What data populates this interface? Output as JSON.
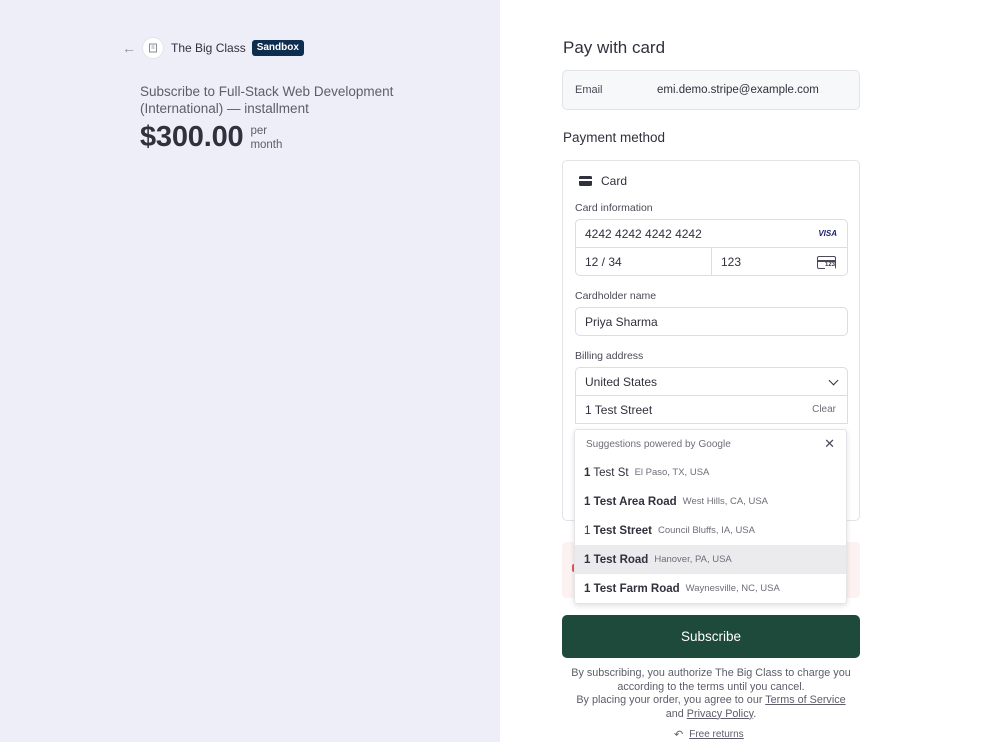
{
  "merchant": {
    "name": "The Big Class",
    "badge": "Sandbox"
  },
  "product": {
    "name": "Subscribe to Full-Stack Web Development (International) — installment",
    "price": "$300.00",
    "period_line1": "per",
    "period_line2": "month"
  },
  "checkout": {
    "title": "Pay with card",
    "email_label": "Email",
    "email_value": "emi.demo.stripe@example.com",
    "payment_method_title": "Payment method",
    "card_tab_label": "Card",
    "card_info_label": "Card information",
    "card_number": "4242 4242 4242 4242",
    "card_brand": "VISA",
    "expiry": "12 / 34",
    "cvc": "123",
    "cvc_icon_text": "123",
    "cardholder_label": "Cardholder name",
    "cardholder_value": "Priya Sharma",
    "billing_label": "Billing address",
    "country": "United States",
    "address_line1": "1 Test Street",
    "clear_label": "Clear",
    "subscribe_label": "Subscribe"
  },
  "suggestions": {
    "header": "Suggestions powered by",
    "google": "Google",
    "close": "✕",
    "items": [
      {
        "bold": "1",
        "plain": "Test St",
        "sub": "El Paso, TX, USA"
      },
      {
        "bold": "1 Test Area Road",
        "plain": "",
        "sub": "West Hills, CA, USA"
      },
      {
        "bold_prefix": "1",
        "bold": "Test Street",
        "sub": "Council Bluffs, IA, USA"
      },
      {
        "bold": "1 Test Road",
        "plain": "",
        "sub": "Hanover, PA, USA"
      },
      {
        "bold": "1 Test Farm Road",
        "plain": "",
        "sub": "Waynesville, NC, USA"
      }
    ]
  },
  "legal": {
    "line1": "By subscribing, you authorize The Big Class to charge you according to the terms until you cancel.",
    "line2_pre": "By placing your order, you agree to our",
    "terms": "Terms of Service",
    "and": "and",
    "privacy": "Privacy Policy",
    "period": "."
  },
  "returns": {
    "icon": "↶",
    "label": "Free returns"
  },
  "colors": {
    "left_bg": "#eeeef9",
    "subscribe_bg": "#1d4a3b",
    "sandbox_bg": "#0e2e4f"
  }
}
